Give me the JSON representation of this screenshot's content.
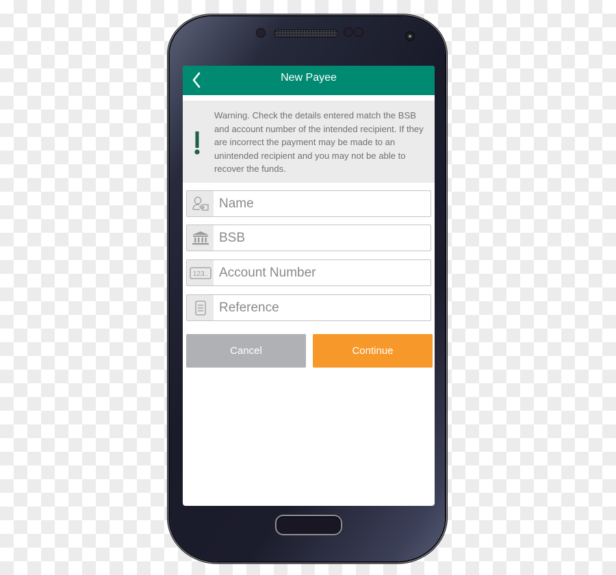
{
  "header": {
    "title": "New Payee",
    "back_icon": "chevron-left-icon"
  },
  "warning": {
    "icon": "exclamation-icon",
    "text": "Warning. Check the details entered match the BSB and account number of the intended recipient. If they are incorrect the payment may be made to an unintended recipient and you may not be able to recover the funds."
  },
  "form": {
    "fields": [
      {
        "icon": "person-tag-icon",
        "placeholder": "Name",
        "value": ""
      },
      {
        "icon": "bank-icon",
        "placeholder": "BSB",
        "value": ""
      },
      {
        "icon": "number-123-icon",
        "icon_text": "123..",
        "placeholder": "Account Number",
        "value": ""
      },
      {
        "icon": "document-icon",
        "placeholder": "Reference",
        "value": ""
      }
    ]
  },
  "actions": {
    "cancel_label": "Cancel",
    "continue_label": "Continue"
  },
  "colors": {
    "header_bg": "#008a72",
    "warning_bg": "#ebebeb",
    "warning_icon": "#1f5e48",
    "cancel_bg": "#b0b1b4",
    "continue_bg": "#f7992a"
  }
}
